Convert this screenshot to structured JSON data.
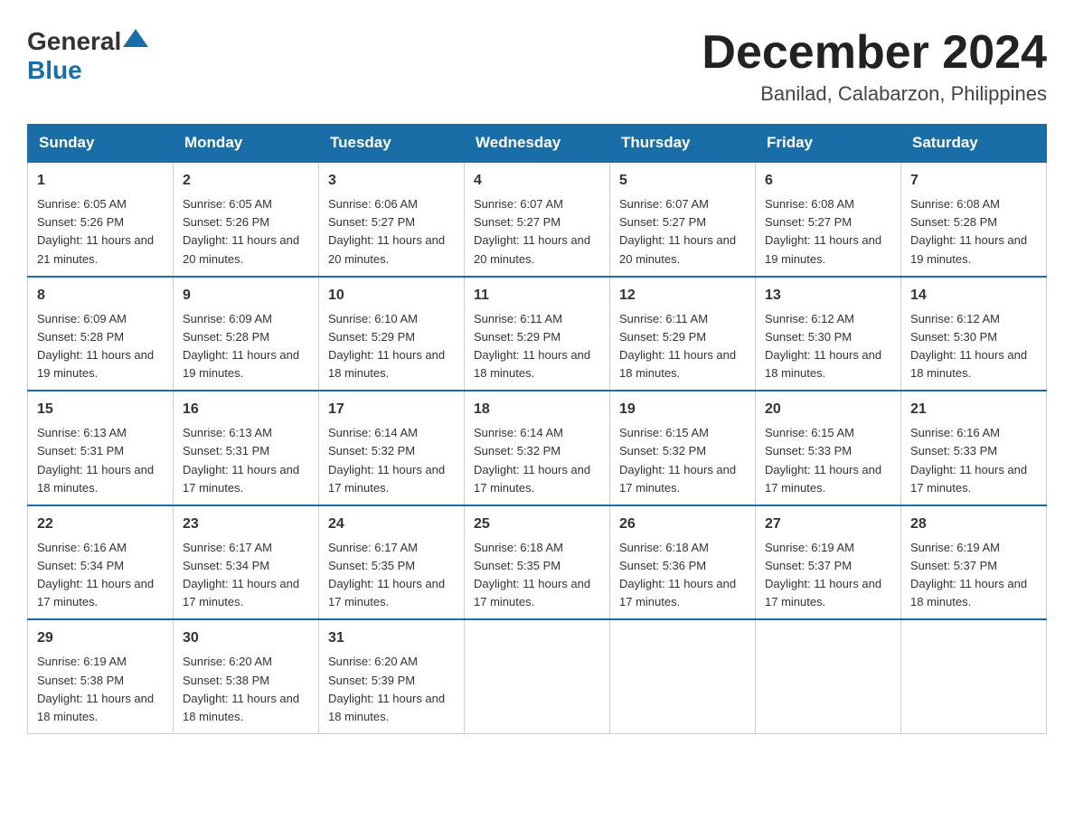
{
  "header": {
    "logo_general": "General",
    "logo_blue": "Blue",
    "month_title": "December 2024",
    "subtitle": "Banilad, Calabarzon, Philippines"
  },
  "days_of_week": [
    "Sunday",
    "Monday",
    "Tuesday",
    "Wednesday",
    "Thursday",
    "Friday",
    "Saturday"
  ],
  "weeks": [
    [
      {
        "day": "1",
        "sunrise": "6:05 AM",
        "sunset": "5:26 PM",
        "daylight": "11 hours and 21 minutes."
      },
      {
        "day": "2",
        "sunrise": "6:05 AM",
        "sunset": "5:26 PM",
        "daylight": "11 hours and 20 minutes."
      },
      {
        "day": "3",
        "sunrise": "6:06 AM",
        "sunset": "5:27 PM",
        "daylight": "11 hours and 20 minutes."
      },
      {
        "day": "4",
        "sunrise": "6:07 AM",
        "sunset": "5:27 PM",
        "daylight": "11 hours and 20 minutes."
      },
      {
        "day": "5",
        "sunrise": "6:07 AM",
        "sunset": "5:27 PM",
        "daylight": "11 hours and 20 minutes."
      },
      {
        "day": "6",
        "sunrise": "6:08 AM",
        "sunset": "5:27 PM",
        "daylight": "11 hours and 19 minutes."
      },
      {
        "day": "7",
        "sunrise": "6:08 AM",
        "sunset": "5:28 PM",
        "daylight": "11 hours and 19 minutes."
      }
    ],
    [
      {
        "day": "8",
        "sunrise": "6:09 AM",
        "sunset": "5:28 PM",
        "daylight": "11 hours and 19 minutes."
      },
      {
        "day": "9",
        "sunrise": "6:09 AM",
        "sunset": "5:28 PM",
        "daylight": "11 hours and 19 minutes."
      },
      {
        "day": "10",
        "sunrise": "6:10 AM",
        "sunset": "5:29 PM",
        "daylight": "11 hours and 18 minutes."
      },
      {
        "day": "11",
        "sunrise": "6:11 AM",
        "sunset": "5:29 PM",
        "daylight": "11 hours and 18 minutes."
      },
      {
        "day": "12",
        "sunrise": "6:11 AM",
        "sunset": "5:29 PM",
        "daylight": "11 hours and 18 minutes."
      },
      {
        "day": "13",
        "sunrise": "6:12 AM",
        "sunset": "5:30 PM",
        "daylight": "11 hours and 18 minutes."
      },
      {
        "day": "14",
        "sunrise": "6:12 AM",
        "sunset": "5:30 PM",
        "daylight": "11 hours and 18 minutes."
      }
    ],
    [
      {
        "day": "15",
        "sunrise": "6:13 AM",
        "sunset": "5:31 PM",
        "daylight": "11 hours and 18 minutes."
      },
      {
        "day": "16",
        "sunrise": "6:13 AM",
        "sunset": "5:31 PM",
        "daylight": "11 hours and 17 minutes."
      },
      {
        "day": "17",
        "sunrise": "6:14 AM",
        "sunset": "5:32 PM",
        "daylight": "11 hours and 17 minutes."
      },
      {
        "day": "18",
        "sunrise": "6:14 AM",
        "sunset": "5:32 PM",
        "daylight": "11 hours and 17 minutes."
      },
      {
        "day": "19",
        "sunrise": "6:15 AM",
        "sunset": "5:32 PM",
        "daylight": "11 hours and 17 minutes."
      },
      {
        "day": "20",
        "sunrise": "6:15 AM",
        "sunset": "5:33 PM",
        "daylight": "11 hours and 17 minutes."
      },
      {
        "day": "21",
        "sunrise": "6:16 AM",
        "sunset": "5:33 PM",
        "daylight": "11 hours and 17 minutes."
      }
    ],
    [
      {
        "day": "22",
        "sunrise": "6:16 AM",
        "sunset": "5:34 PM",
        "daylight": "11 hours and 17 minutes."
      },
      {
        "day": "23",
        "sunrise": "6:17 AM",
        "sunset": "5:34 PM",
        "daylight": "11 hours and 17 minutes."
      },
      {
        "day": "24",
        "sunrise": "6:17 AM",
        "sunset": "5:35 PM",
        "daylight": "11 hours and 17 minutes."
      },
      {
        "day": "25",
        "sunrise": "6:18 AM",
        "sunset": "5:35 PM",
        "daylight": "11 hours and 17 minutes."
      },
      {
        "day": "26",
        "sunrise": "6:18 AM",
        "sunset": "5:36 PM",
        "daylight": "11 hours and 17 minutes."
      },
      {
        "day": "27",
        "sunrise": "6:19 AM",
        "sunset": "5:37 PM",
        "daylight": "11 hours and 17 minutes."
      },
      {
        "day": "28",
        "sunrise": "6:19 AM",
        "sunset": "5:37 PM",
        "daylight": "11 hours and 18 minutes."
      }
    ],
    [
      {
        "day": "29",
        "sunrise": "6:19 AM",
        "sunset": "5:38 PM",
        "daylight": "11 hours and 18 minutes."
      },
      {
        "day": "30",
        "sunrise": "6:20 AM",
        "sunset": "5:38 PM",
        "daylight": "11 hours and 18 minutes."
      },
      {
        "day": "31",
        "sunrise": "6:20 AM",
        "sunset": "5:39 PM",
        "daylight": "11 hours and 18 minutes."
      },
      null,
      null,
      null,
      null
    ]
  ]
}
